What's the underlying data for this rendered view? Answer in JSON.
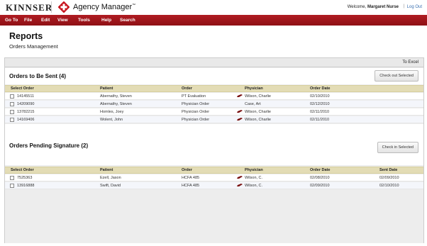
{
  "header": {
    "brand": "KINNSER",
    "app_name": "Agency Manager",
    "trademark": "™",
    "welcome_prefix": "Welcome,",
    "user_name": "Margaret Nurse",
    "separator": "|",
    "logout": "Log Out"
  },
  "menu": {
    "items": [
      "Go To",
      "File",
      "Edit",
      "View",
      "Tools",
      "Help",
      "Search"
    ]
  },
  "page": {
    "title": "Reports",
    "subtitle": "Orders Management"
  },
  "toolbar": {
    "to_excel": "To Excel"
  },
  "orders_to_send": {
    "title": "Orders to Be Sent (4)",
    "button": "Check out Selected",
    "columns": [
      "Select Order",
      "Patient",
      "Order",
      "Physician",
      "Order Date"
    ],
    "rows": [
      {
        "id": "14145511",
        "patient": "Abernathy, Steven",
        "order": "PT Evaluation",
        "physician": "Wilson, Charlie",
        "pen": true,
        "date": "02/10/2010"
      },
      {
        "id": "14209090",
        "patient": "Abernathy, Steven",
        "order": "Physician Order",
        "physician": "Case, Art",
        "pen": false,
        "date": "02/12/2010"
      },
      {
        "id": "13782215",
        "patient": "Homles, Joey",
        "order": "Physician Order",
        "physician": "Wilson, Charlie",
        "pen": true,
        "date": "02/11/2010"
      },
      {
        "id": "14169406",
        "patient": "Wolent, John",
        "order": "Physician Order",
        "physician": "Wilson, Charlie",
        "pen": true,
        "date": "02/11/2010"
      }
    ]
  },
  "orders_pending": {
    "title": "Orders Pending Signature (2)",
    "button": "Check in Selected",
    "columns": [
      "Select Order",
      "Patient",
      "Order",
      "Physician",
      "Order Date",
      "Sent Date"
    ],
    "rows": [
      {
        "id": "7525363",
        "patient": "Ezell, Jason",
        "order": "HCFA 485",
        "physician": "Wilson, C.",
        "pen": true,
        "date": "02/08/2010",
        "sent": "02/09/2010"
      },
      {
        "id": "13916888",
        "patient": "Swift, David",
        "order": "HCFA 485",
        "physician": "Wilson, C.",
        "pen": true,
        "date": "02/09/2010",
        "sent": "02/10/2010"
      }
    ]
  },
  "colors": {
    "menubar": "#a3161c",
    "logo_red": "#c8151e",
    "table_header": "#e3dcb5",
    "pen_red": "#7a1010",
    "link": "#3a6fb0"
  }
}
